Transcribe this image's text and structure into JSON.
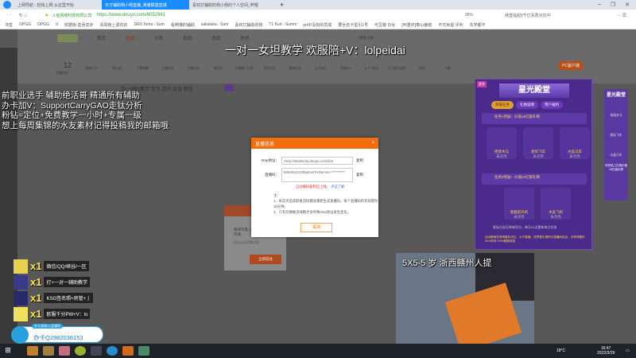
{
  "browser": {
    "tabs": [
      "上网导航 - 轻快上网 从这里开始",
      "天才辅助杨小杨直播_英雄联盟直播",
      "喜欢打辅助的杨小杨的个人空间_哔哩"
    ],
    "site_name": "斗鱼网络科技有限公司",
    "url": "https://www.douyu.com/6052941",
    "zoom": "95%",
    "search": "拜登提起8千亿军费对抗中",
    "bookmarks": [
      "书签",
      "OPGG",
      "OPGG",
      "d",
      "依据库-盒贡发步",
      "青阳拖上源花的",
      "DRX Keria - Sum",
      "看啊懂的辅助",
      "sakalaka - Sum",
      "喜欢打辅助的杨",
      "T1 Kurl - Summ",
      "prt中没有的员成",
      "要全名卡型引1号",
      "可豆瓣 日女",
      "[叫重庆]泰山番暗",
      "不冗世屋 评利",
      "东学都不"
    ]
  },
  "douyu": {
    "nav": [
      "首页",
      "直播",
      "分类",
      "视频",
      "游戏",
      "鱼吧"
    ],
    "search_placeholder": "搜索小杨",
    "level": "12",
    "level_label": "主播积分",
    "toolbar": [
      "直播开关",
      "弹出器",
      "下播提醒",
      "主播红包",
      "主播任务",
      "福利社",
      "开播推广计划",
      "发财项目",
      "星粉任务",
      "天方支付",
      "直播BPI",
      "上个一帆风",
      "分飞前往选择",
      "粉丝",
      "书籍"
    ],
    "room_title": "第一辅助教学 宝鸟 游击 运营 教程",
    "pc_button": "PC客户端"
  },
  "overlays": {
    "top": "一对一女坦教学 欢服陪+V：lolpeidai",
    "left_lines": [
      "前职业选手 辅助绝活哥 精通所有辅助",
      "办卡加V：SupportCarryGAO走钛分析",
      "粉钻=定位+免费教学一小时+专属一级",
      "想上每周集锦的水友素材记得投稿我的邮箱哦"
    ],
    "cam_caption": "5X5-5 岁 浙西赣州人提"
  },
  "dialog": {
    "title": "直播信息",
    "close_x": "×",
    "rtmp_label": "rtmp地址：",
    "rtmp_value": "rtmp://sendtc3a.douyu.com/live",
    "key_label": "直播码：",
    "key_value": "6052941rO3bpEx8?txSecret=**********",
    "copy": "复制",
    "warning": "自动播码复制已上线。",
    "learn": "点这了解",
    "note_title": "注：",
    "notes": [
      "1、每次点击获取推流码都会重新生成直播码，每个直播码的有效期为15分钟。",
      "2、只有切换推流线路才会导致rtmp地址发生变化。"
    ],
    "close_button": "关闭"
  },
  "behind_dialog": {
    "text": "每开可发 App内请",
    "hint": "进击无法观看内容",
    "button": "立即前往"
  },
  "event_panel": {
    "badge": "更多",
    "title": "星光殿堂",
    "subtitle": "活动时间",
    "tabs": [
      "荣誉任务",
      "礼物说明",
      "用户福利"
    ],
    "task1": "任务1奖励：价值18亿级礼物",
    "task2": "任务2奖励：价值24亿级礼物",
    "gifts1": [
      {
        "name": "摇摇木马",
        "status": "未点亮"
      },
      {
        "name": "星际飞车",
        "status": "未点亮"
      },
      {
        "name": "水晶马车",
        "status": "未点亮"
      }
    ],
    "gifts2": [
      {
        "name": "星舰前升机",
        "status": "未点亮"
      },
      {
        "name": "水晶飞机",
        "status": "未点亮"
      }
    ],
    "footer": "星际白金石带来积分，每天24点更新每日任务",
    "bottom_note": "活动期间在获得星际光石，大于星值，送梦星礼物积分直播间送出，可获得额外50%折扣+20%超额奖励"
  },
  "side_widget": {
    "title": "星光殿堂",
    "items": [
      "摇摇木马",
      "星际飞车",
      "水晶马车"
    ],
    "footer": "你完成上礼物价值18亿级礼物"
  },
  "gift_list": [
    {
      "count": "x1",
      "text": "微信/QQ/峡谷/一区"
    },
    {
      "count": "x1",
      "text": "打+一对一辅助教学"
    },
    {
      "count": "x1",
      "text": "KSG签名照+房管+亅"
    },
    {
      "count": "x1",
      "text": "欧服千分PW+V：lo"
    }
  ],
  "qq_badge": {
    "header": "办卡咨询/入会福利",
    "text": "办卡Q2982036153"
  },
  "taskbar": {
    "temp": "18°C",
    "time": "16:47",
    "date": "2022/3/29"
  },
  "colors": {
    "accent": "#f26d0c",
    "panel": "#4a2a8a",
    "browser_tab": "#1a8cff"
  }
}
